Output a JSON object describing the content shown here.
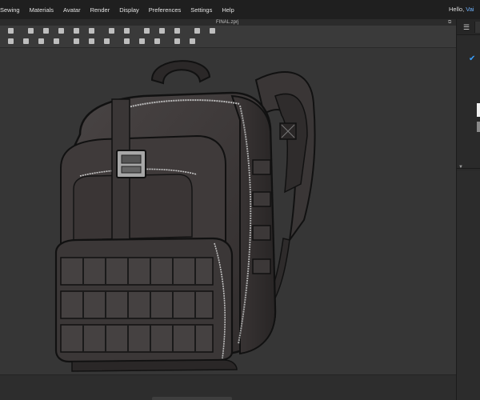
{
  "menu": {
    "items": [
      "Sewing",
      "Materials",
      "Avatar",
      "Render",
      "Display",
      "Preferences",
      "Settings",
      "Help"
    ]
  },
  "header": {
    "greeting": "Hello,",
    "user": "Vai"
  },
  "document": {
    "filename": "FINAL.zprj"
  },
  "icons": {
    "window_restore": "restore-icon",
    "panel_list": "list-icon",
    "status_check": "check-icon",
    "panel_collapse": "collapse-icon"
  },
  "colors": {
    "accent": "#3aa0ff",
    "menubar": "#1f1f1f",
    "viewport": "#363636",
    "bag_fabric": "#3d3838"
  },
  "viewport": {
    "subject": "backpack-3d-model"
  }
}
